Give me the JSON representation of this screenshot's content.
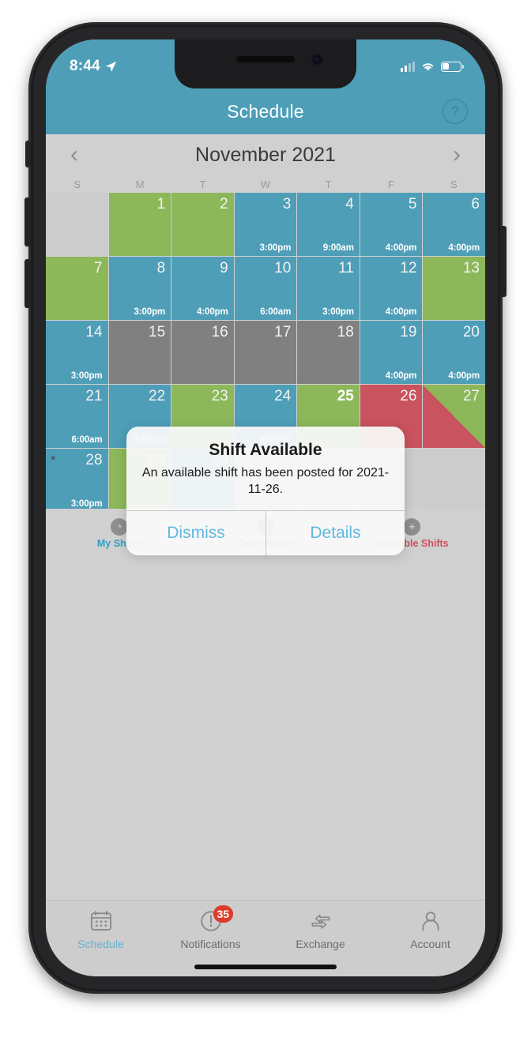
{
  "status_bar": {
    "time": "8:44",
    "location_icon": "location-arrow-icon",
    "signal_icon": "cellular-signal-icon",
    "wifi_icon": "wifi-icon",
    "battery_icon": "battery-icon",
    "battery_level_pct": 32
  },
  "nav": {
    "title": "Schedule",
    "help_label": "?"
  },
  "month_bar": {
    "prev_label": "‹",
    "title": "November 2021",
    "next_label": "›"
  },
  "weekdays": [
    "S",
    "M",
    "T",
    "W",
    "T",
    "F",
    "S"
  ],
  "calendar": {
    "cells": [
      {
        "day": "",
        "state": "empty"
      },
      {
        "day": "1",
        "state": "green"
      },
      {
        "day": "2",
        "state": "green"
      },
      {
        "day": "3",
        "state": "blue",
        "time": "3:00pm"
      },
      {
        "day": "4",
        "state": "blue",
        "time": "9:00am"
      },
      {
        "day": "5",
        "state": "blue",
        "time": "4:00pm"
      },
      {
        "day": "6",
        "state": "blue",
        "time": "4:00pm"
      },
      {
        "day": "7",
        "state": "green"
      },
      {
        "day": "8",
        "state": "blue",
        "time": "3:00pm"
      },
      {
        "day": "9",
        "state": "blue",
        "time": "4:00pm"
      },
      {
        "day": "10",
        "state": "blue",
        "time": "6:00am"
      },
      {
        "day": "11",
        "state": "blue",
        "time": "3:00pm"
      },
      {
        "day": "12",
        "state": "blue",
        "time": "4:00pm"
      },
      {
        "day": "13",
        "state": "green"
      },
      {
        "day": "14",
        "state": "blue",
        "time": "3:00pm"
      },
      {
        "day": "15",
        "state": "gray"
      },
      {
        "day": "16",
        "state": "gray"
      },
      {
        "day": "17",
        "state": "gray"
      },
      {
        "day": "18",
        "state": "gray"
      },
      {
        "day": "19",
        "state": "blue",
        "time": "4:00pm"
      },
      {
        "day": "20",
        "state": "blue",
        "time": "4:00pm"
      },
      {
        "day": "21",
        "state": "blue",
        "time": "6:00am"
      },
      {
        "day": "22",
        "state": "blue",
        "time": "6:00am"
      },
      {
        "day": "23",
        "state": "green"
      },
      {
        "day": "24",
        "state": "blue",
        "time": "6:00am"
      },
      {
        "day": "25",
        "state": "green",
        "today": true
      },
      {
        "day": "26",
        "state": "red"
      },
      {
        "day": "27",
        "state": "split"
      },
      {
        "day": "28",
        "state": "blue",
        "time": "3:00pm",
        "star": "*"
      },
      {
        "day": "29",
        "state": "green"
      },
      {
        "day": "30",
        "state": "blue"
      },
      {
        "day": "",
        "state": "empty"
      },
      {
        "day": "",
        "state": "empty"
      },
      {
        "day": "",
        "state": "empty"
      },
      {
        "day": "",
        "state": "empty"
      }
    ]
  },
  "action_row": {
    "items": [
      {
        "label": "My Shifts",
        "icon": "clock-icon",
        "glyph": "◔"
      },
      {
        "label": "Open Shifts",
        "icon": "list-icon",
        "glyph": "≡"
      },
      {
        "label": "Available Shifts",
        "icon": "plus-icon",
        "glyph": "+"
      }
    ]
  },
  "alert": {
    "title": "Shift Available",
    "message": "An available shift has been posted for 2021-11-26.",
    "dismiss_label": "Dismiss",
    "details_label": "Details"
  },
  "tabs": [
    {
      "label": "Schedule",
      "icon": "calendar-icon",
      "active": true
    },
    {
      "label": "Notifications",
      "icon": "exclamation-circle-icon",
      "badge": "35"
    },
    {
      "label": "Exchange",
      "icon": "exchange-arrows-icon"
    },
    {
      "label": "Account",
      "icon": "person-icon"
    }
  ],
  "colors": {
    "accent_blue": "#4e9eb8",
    "shift_green": "#8cb85a",
    "shift_red": "#c9535e",
    "unavailable_gray": "#808080",
    "background_gray": "#d0d0d0",
    "badge_red": "#dd3c2a",
    "link_blue": "#5fb9e0"
  }
}
